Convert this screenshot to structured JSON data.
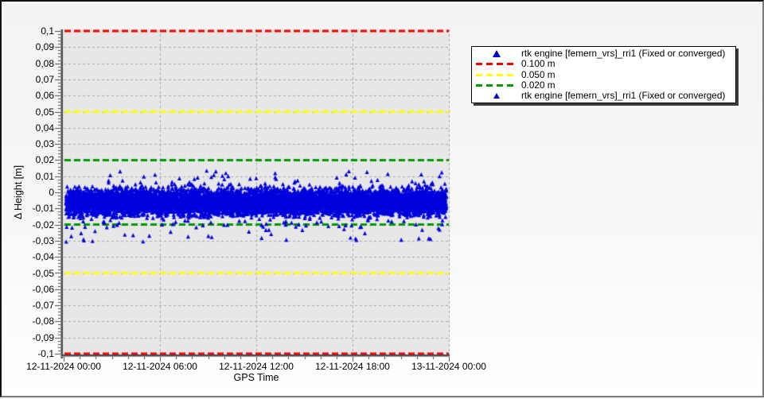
{
  "chart_data": {
    "type": "scatter",
    "title": "",
    "xlabel": "GPS Time",
    "ylabel": "Δ Height [m]",
    "x_tick_labels": [
      "12-11-2024 00:00",
      "12-11-2024 06:00",
      "12-11-2024 12:00",
      "12-11-2024 18:00",
      "13-11-2024 00:00"
    ],
    "x_minor_ticks_per_major": 6,
    "ylim": [
      -0.1,
      0.1
    ],
    "y_major_step": 0.01,
    "y_minor_step": 0.002,
    "y_tick_labels": [
      "0,1",
      "0,09",
      "0,08",
      "0,07",
      "0,06",
      "0,05",
      "0,04",
      "0,03",
      "0,02",
      "0,01",
      "0",
      "-0,01",
      "-0,02",
      "-0,03",
      "-0,04",
      "-0,05",
      "-0,06",
      "-0,07",
      "-0,08",
      "-0,09",
      "-0,1"
    ],
    "grid": true,
    "plot_bg_color": "#e7e7e7",
    "grid_color": "#a8a8a8",
    "axis_color": "#4d4d4d",
    "reference_lines": [
      {
        "y": 0.1,
        "color": "#f80000",
        "label": "0.100 m"
      },
      {
        "y": 0.05,
        "color": "#ffff00",
        "label": "0.050 m"
      },
      {
        "y": 0.02,
        "color": "#009b00",
        "label": "0.020 m"
      },
      {
        "y": -0.02,
        "color": "#009b00",
        "label": "0.020 m"
      },
      {
        "y": -0.05,
        "color": "#ffff00",
        "label": "0.050 m"
      },
      {
        "y": -0.1,
        "color": "#f80000",
        "label": "0.100 m"
      }
    ],
    "series": [
      {
        "name": "rtk engine [femern_vrs]_rri1 (Fixed or converged)",
        "marker": "triangle",
        "color": "#0202dd",
        "summary": {
          "description": "dense continuous band of height residuals over 24 h",
          "mean": -0.006,
          "dense_band": [
            -0.018,
            0.004
          ],
          "spikes_up_to": 0.013,
          "outliers_down_to": -0.031,
          "within_0.020_m": "almost all samples"
        }
      }
    ]
  },
  "legend": {
    "items": [
      {
        "label": "rtk engine [femern_vrs]_rri1 (Fixed or converged)",
        "marker": "triangle",
        "size": "large",
        "color": "#0202dd"
      },
      {
        "label": "0.100 m",
        "marker": "dash",
        "color": "#f80000"
      },
      {
        "label": "0.050 m",
        "marker": "dash",
        "color": "#ffff00"
      },
      {
        "label": "0.020 m",
        "marker": "dash",
        "color": "#009b00"
      },
      {
        "label": "rtk engine [femern_vrs]_rri1 (Fixed or converged)",
        "marker": "triangle",
        "size": "small",
        "color": "#0202dd"
      }
    ]
  }
}
